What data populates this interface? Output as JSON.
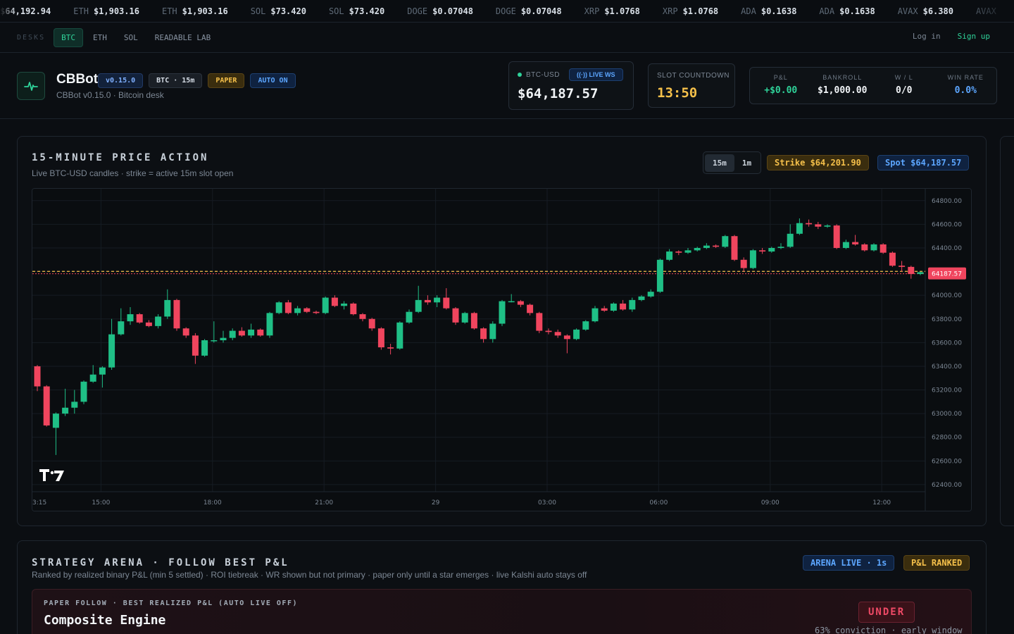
{
  "ticker": [
    {
      "sym": "",
      "price": "$64,192.94"
    },
    {
      "sym": "ETH",
      "price": "$1,903.16"
    },
    {
      "sym": "ETH",
      "price": "$1,903.16"
    },
    {
      "sym": "SOL",
      "price": "$73.420"
    },
    {
      "sym": "SOL",
      "price": "$73.420"
    },
    {
      "sym": "DOGE",
      "price": "$0.07048"
    },
    {
      "sym": "DOGE",
      "price": "$0.07048"
    },
    {
      "sym": "XRP",
      "price": "$1.0768"
    },
    {
      "sym": "XRP",
      "price": "$1.0768"
    },
    {
      "sym": "ADA",
      "price": "$0.1638"
    },
    {
      "sym": "ADA",
      "price": "$0.1638"
    },
    {
      "sym": "AVAX",
      "price": "$6.380"
    },
    {
      "sym": "AVAX",
      "price": ""
    }
  ],
  "nav": {
    "desks_label": "DESKS",
    "tabs": [
      "BTC",
      "ETH",
      "SOL",
      "READABLE LAB"
    ],
    "active_tab": "BTC",
    "login": "Log in",
    "signup": "Sign up"
  },
  "header": {
    "app_name": "CBBot",
    "subtitle": "CBBot v0.15.0 · Bitcoin desk",
    "badges": {
      "version": "v0.15.0",
      "pair": "BTC · 15m",
      "mode": "PAPER",
      "auto": "AUTO ON"
    },
    "price_card": {
      "label": "BTC-USD",
      "live": "LIVE WS",
      "price": "$64,187.57"
    },
    "countdown": {
      "label": "SLOT COUNTDOWN",
      "value": "13:50"
    },
    "stats": [
      {
        "label": "P&L",
        "value": "+$0.00",
        "color": "#2fd39a"
      },
      {
        "label": "BANKROLL",
        "value": "$1,000.00",
        "color": "#f1f4f7"
      },
      {
        "label": "W / L",
        "value": "0/0",
        "color": "#f1f4f7"
      },
      {
        "label": "WIN RATE",
        "value": "0.0%",
        "color": "#5ca6ff"
      }
    ]
  },
  "chart_panel": {
    "title": "15-MINUTE PRICE ACTION",
    "subtitle": "Live BTC-USD candles · strike = active 15m slot open",
    "timeframes": [
      "15m",
      "1m"
    ],
    "active_timeframe": "15m",
    "strike_pill": "Strike $64,201.90",
    "spot_pill": "Spot $64,187.57",
    "price_tag": "64187.57",
    "watermark": "TV"
  },
  "chart_data": {
    "type": "candlestick",
    "ylim": [
      62340,
      64900
    ],
    "yticks": [
      "64800.00",
      "64600.00",
      "64400.00",
      "64200.00",
      "64000.00",
      "63800.00",
      "63600.00",
      "63400.00",
      "63200.00",
      "63000.00",
      "62800.00",
      "62600.00",
      "62400.00"
    ],
    "ytick_values": [
      64800,
      64600,
      64400,
      64200,
      64000,
      63800,
      63600,
      63400,
      63200,
      63000,
      62800,
      62600,
      62400
    ],
    "xticks": [
      {
        "label": "3:15",
        "index": 0
      },
      {
        "label": "15:00",
        "index": 7
      },
      {
        "label": "18:00",
        "index": 19
      },
      {
        "label": "21:00",
        "index": 31
      },
      {
        "label": "29",
        "index": 43
      },
      {
        "label": "03:00",
        "index": 55
      },
      {
        "label": "06:00",
        "index": 67
      },
      {
        "label": "09:00",
        "index": 79
      },
      {
        "label": "12:00",
        "index": 91
      }
    ],
    "strike": 64201.9,
    "spot": 64187.57,
    "colors": {
      "up": "#1fbf86",
      "down": "#f0455e"
    },
    "candles": [
      [
        63400,
        63400,
        63230,
        63190,
        63410
      ],
      [
        63230,
        63230,
        62900,
        62890,
        63240
      ],
      [
        62880,
        62880,
        63000,
        62650,
        63010
      ],
      [
        63000,
        63000,
        63050,
        62980,
        63210
      ],
      [
        63050,
        63050,
        63100,
        63000,
        63200
      ],
      [
        63100,
        63100,
        63270,
        63080,
        63280
      ],
      [
        63270,
        63270,
        63330,
        63260,
        63410
      ],
      [
        63330,
        63330,
        63390,
        63220,
        63400
      ],
      [
        63390,
        63390,
        63670,
        63370,
        63800
      ],
      [
        63670,
        63670,
        63780,
        63660,
        63890
      ],
      [
        63780,
        63780,
        63840,
        63750,
        63900
      ],
      [
        63840,
        63840,
        63770,
        63760,
        63850
      ],
      [
        63770,
        63770,
        63740,
        63730,
        63790
      ],
      [
        63740,
        63740,
        63820,
        63720,
        63840
      ],
      [
        63820,
        63820,
        63960,
        63800,
        64050
      ],
      [
        63960,
        63960,
        63720,
        63700,
        63970
      ],
      [
        63720,
        63720,
        63660,
        63640,
        63730
      ],
      [
        63660,
        63660,
        63490,
        63420,
        63680
      ],
      [
        63490,
        63490,
        63620,
        63480,
        63630
      ],
      [
        63620,
        63620,
        63620,
        63600,
        63780
      ],
      [
        63620,
        63620,
        63640,
        63600,
        63700
      ],
      [
        63640,
        63640,
        63700,
        63620,
        63720
      ],
      [
        63700,
        63700,
        63660,
        63650,
        63730
      ],
      [
        63660,
        63660,
        63710,
        63640,
        63760
      ],
      [
        63710,
        63710,
        63660,
        63650,
        63720
      ],
      [
        63660,
        63660,
        63850,
        63640,
        63860
      ],
      [
        63850,
        63850,
        63940,
        63840,
        63950
      ],
      [
        63940,
        63940,
        63850,
        63840,
        63960
      ],
      [
        63850,
        63850,
        63890,
        63830,
        63910
      ],
      [
        63890,
        63890,
        63860,
        63850,
        63900
      ],
      [
        63860,
        63860,
        63850,
        63840,
        63870
      ],
      [
        63850,
        63850,
        63980,
        63840,
        63990
      ],
      [
        63980,
        63980,
        63910,
        63900,
        64000
      ],
      [
        63910,
        63910,
        63930,
        63880,
        63950
      ],
      [
        63930,
        63930,
        63840,
        63830,
        63940
      ],
      [
        63840,
        63840,
        63800,
        63780,
        63850
      ],
      [
        63800,
        63800,
        63720,
        63700,
        63810
      ],
      [
        63720,
        63720,
        63560,
        63540,
        63730
      ],
      [
        63560,
        63560,
        63550,
        63500,
        63590
      ],
      [
        63550,
        63550,
        63770,
        63540,
        63780
      ],
      [
        63770,
        63770,
        63860,
        63760,
        63880
      ],
      [
        63860,
        63860,
        63960,
        63850,
        64080
      ],
      [
        63960,
        63960,
        63940,
        63920,
        64000
      ],
      [
        63940,
        63940,
        63980,
        63900,
        64000
      ],
      [
        63980,
        63980,
        63890,
        63880,
        64060
      ],
      [
        63890,
        63890,
        63770,
        63750,
        63900
      ],
      [
        63770,
        63770,
        63850,
        63760,
        63860
      ],
      [
        63850,
        63850,
        63720,
        63710,
        63860
      ],
      [
        63720,
        63720,
        63630,
        63600,
        63730
      ],
      [
        63630,
        63630,
        63760,
        63600,
        63780
      ],
      [
        63760,
        63760,
        63950,
        63740,
        63960
      ],
      [
        63950,
        63950,
        63950,
        63940,
        64010
      ],
      [
        63950,
        63950,
        63920,
        63900,
        63960
      ],
      [
        63920,
        63920,
        63850,
        63830,
        63930
      ],
      [
        63850,
        63850,
        63700,
        63680,
        63860
      ],
      [
        63700,
        63700,
        63690,
        63670,
        63720
      ],
      [
        63690,
        63690,
        63660,
        63640,
        63710
      ],
      [
        63660,
        63660,
        63630,
        63510,
        63670
      ],
      [
        63630,
        63630,
        63710,
        63620,
        63720
      ],
      [
        63710,
        63710,
        63780,
        63700,
        63790
      ],
      [
        63780,
        63780,
        63890,
        63770,
        63910
      ],
      [
        63890,
        63890,
        63870,
        63860,
        63910
      ],
      [
        63870,
        63870,
        63930,
        63860,
        63940
      ],
      [
        63930,
        63930,
        63880,
        63870,
        63960
      ],
      [
        63880,
        63880,
        63960,
        63860,
        63980
      ],
      [
        63960,
        63960,
        63990,
        63950,
        64000
      ],
      [
        63990,
        63990,
        64030,
        63980,
        64050
      ],
      [
        64030,
        64030,
        64300,
        64020,
        64310
      ],
      [
        64300,
        64300,
        64370,
        64290,
        64390
      ],
      [
        64370,
        64370,
        64360,
        64340,
        64380
      ],
      [
        64360,
        64360,
        64380,
        64350,
        64400
      ],
      [
        64380,
        64380,
        64400,
        64370,
        64410
      ],
      [
        64400,
        64400,
        64420,
        64390,
        64440
      ],
      [
        64420,
        64420,
        64410,
        64400,
        64430
      ],
      [
        64410,
        64410,
        64500,
        64400,
        64510
      ],
      [
        64500,
        64500,
        64300,
        64290,
        64510
      ],
      [
        64300,
        64300,
        64230,
        64200,
        64320
      ],
      [
        64230,
        64230,
        64380,
        64220,
        64390
      ],
      [
        64380,
        64380,
        64370,
        64350,
        64400
      ],
      [
        64370,
        64370,
        64400,
        64360,
        64410
      ],
      [
        64400,
        64400,
        64410,
        64390,
        64440
      ],
      [
        64410,
        64410,
        64520,
        64400,
        64600
      ],
      [
        64520,
        64520,
        64610,
        64510,
        64650
      ],
      [
        64610,
        64610,
        64600,
        64580,
        64640
      ],
      [
        64600,
        64600,
        64580,
        64560,
        64620
      ],
      [
        64580,
        64580,
        64590,
        64570,
        64600
      ],
      [
        64590,
        64590,
        64400,
        64390,
        64600
      ],
      [
        64400,
        64400,
        64450,
        64390,
        64470
      ],
      [
        64450,
        64450,
        64430,
        64420,
        64510
      ],
      [
        64430,
        64430,
        64380,
        64370,
        64440
      ],
      [
        64380,
        64380,
        64430,
        64370,
        64440
      ],
      [
        64430,
        64430,
        64360,
        64350,
        64440
      ],
      [
        64360,
        64360,
        64250,
        64240,
        64370
      ],
      [
        64250,
        64250,
        64240,
        64200,
        64290
      ],
      [
        64240,
        64240,
        64180,
        64140,
        64250
      ],
      [
        64180,
        64180,
        64195,
        64170,
        64200
      ]
    ]
  },
  "arena": {
    "title": "STRATEGY ARENA · FOLLOW BEST P&L",
    "subtitle": "Ranked by realized binary P&L (min 5 settled) · ROI tiebreak · WR shown but not primary · paper only until a star emerges · live Kalshi auto stays off",
    "live_pill": "ARENA LIVE · 1s",
    "rank_pill": "P&L RANKED",
    "follow_label": "PAPER FOLLOW · BEST REALIZED P&L (AUTO LIVE OFF)",
    "follow_name": "Composite Engine",
    "signal": "UNDER",
    "conviction": "63% conviction · early window"
  }
}
